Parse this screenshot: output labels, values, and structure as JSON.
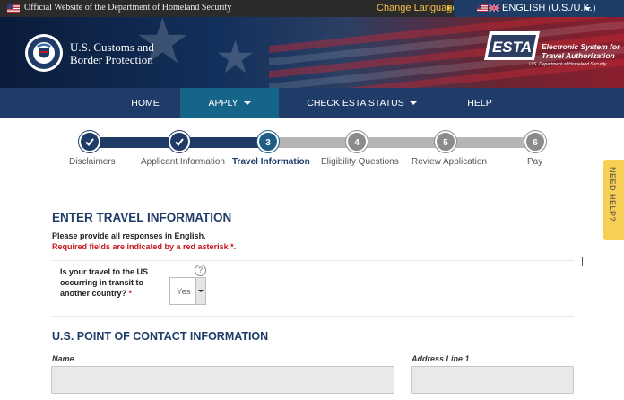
{
  "topbar": {
    "official_text": "Official Website of the Department of Homeland Security",
    "change_language": "Change Language",
    "language": "ENGLISH (U.S./U.K.)"
  },
  "header": {
    "agency_line1": "U.S. Customs and",
    "agency_line2": "Border Protection",
    "esta_logo": "ESTA",
    "esta_line1": "Electronic System for",
    "esta_line2": "Travel Authorization",
    "esta_sub": "U.S. Department of Homeland Security"
  },
  "nav": {
    "items": [
      {
        "label": "HOME"
      },
      {
        "label": "APPLY"
      },
      {
        "label": "CHECK ESTA STATUS"
      },
      {
        "label": "HELP"
      }
    ],
    "active": "APPLY"
  },
  "progress": {
    "steps": [
      {
        "number": "1",
        "label": "Disclaimers",
        "state": "done"
      },
      {
        "number": "2",
        "label": "Applicant Information",
        "state": "done"
      },
      {
        "number": "3",
        "label": "Travel Information",
        "state": "current"
      },
      {
        "number": "4",
        "label": "Eligibility Questions",
        "state": "todo"
      },
      {
        "number": "5",
        "label": "Review Application",
        "state": "todo"
      },
      {
        "number": "6",
        "label": "Pay",
        "state": "todo"
      }
    ]
  },
  "help_tab": "NEED HELP?",
  "form": {
    "title": "ENTER TRAVEL INFORMATION",
    "intro": "Please provide all responses in English.",
    "required_note": "Required fields are indicated by a red asterisk *.",
    "transit_question": {
      "line1": "Is your travel to the US",
      "line2": "occurring in transit to",
      "line3": "another country?",
      "asterisk": "*",
      "selected": "Yes",
      "help_icon": "?"
    },
    "poc_title": "U.S. POINT OF CONTACT INFORMATION",
    "name_label": "Name",
    "name_value": "",
    "address1_label": "Address Line 1",
    "address1_value": ""
  },
  "colors": {
    "nav": "#1f3c68",
    "nav_active": "#15648a",
    "heading": "#1f3c68",
    "required": "#c4161c",
    "help_tab": "#f7cf55",
    "change_language": "#f3c14a"
  }
}
